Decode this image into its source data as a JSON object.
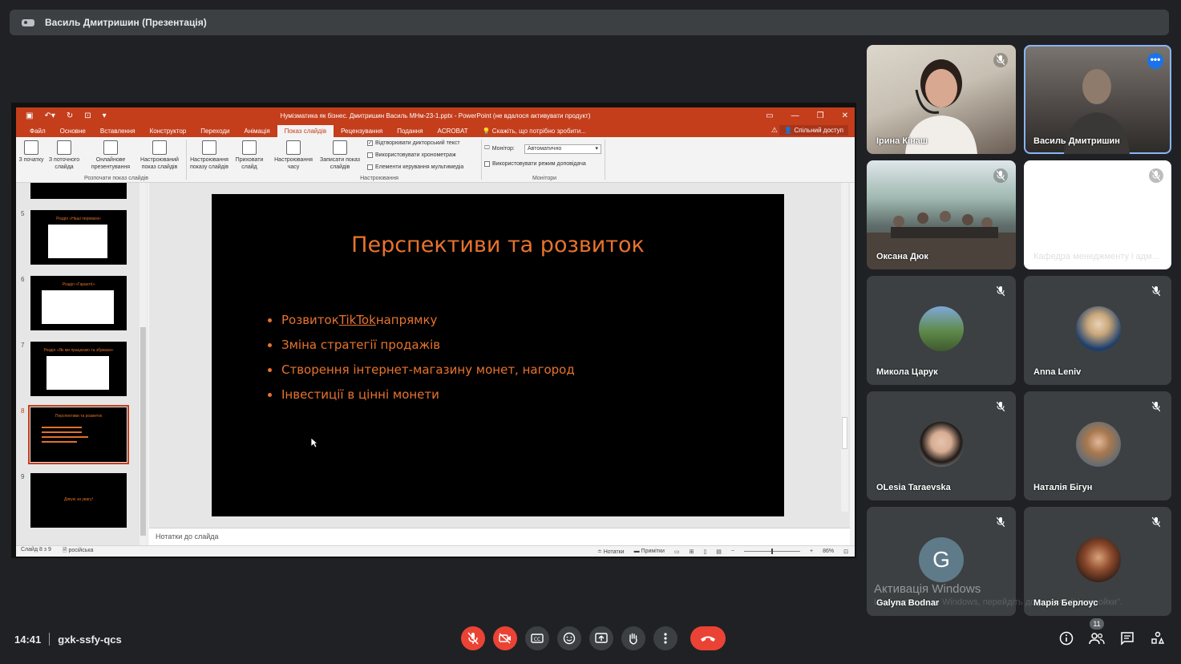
{
  "topbar": {
    "title": "Василь Дмитришин (Презентація)"
  },
  "ppt": {
    "doc_title": "Нумізматика як бізнес. Дмитришин Василь МНм-23-1.pptx - PowerPoint (не вдалося активувати продукт)",
    "tabs": [
      "Файл",
      "Основне",
      "Вставлення",
      "Конструктор",
      "Переходи",
      "Анімація",
      "Показ слайдів",
      "Рецензування",
      "Подання",
      "ACROBAT"
    ],
    "active_tab": "Показ слайдів",
    "tell_me": "Скажіть, що потрібно зробити...",
    "share": "Спільний доступ",
    "ribbon": {
      "btn_from_start": "З початку",
      "btn_from_current": "З поточного слайда",
      "btn_online": "Онлайнове презентування",
      "btn_custom": "Настроюваний показ слайдів",
      "group_start": "Розпочати показ слайдів",
      "btn_setup": "Настроювання показу слайдів",
      "btn_hide": "Приховати слайд",
      "btn_timings": "Настроювання часу",
      "btn_record": "Записати показ слайдів",
      "chk_narration": "Відтворювати дикторський текст",
      "chk_timings": "Використовувати хронометраж",
      "chk_media": "Елементи керування мультимедіа",
      "group_setup": "Настроювання",
      "monitor_label": "Монітор:",
      "monitor_value": "Автоматично",
      "chk_presenter": "Використовувати режим доповідача",
      "group_monitors": "Монітори"
    },
    "thumbnails": [
      {
        "num": "5",
        "title": "Розділ «Наші переваги»"
      },
      {
        "num": "6",
        "title": "Розділ «Гарантії»"
      },
      {
        "num": "7",
        "title": "Розділ «Як ми працюємо та збуваєм»"
      },
      {
        "num": "8",
        "title": "Перспективи та розвиток"
      },
      {
        "num": "9",
        "title": "Дякую за увагу!"
      }
    ],
    "slide": {
      "title": "Перспективи та розвиток",
      "bullet1_pre": "Розвиток ",
      "bullet1_link": "TikTok",
      "bullet1_post": " напрямку",
      "bullet2": "Зміна стратегії продажів",
      "bullet3": "Створення інтернет-магазину монет, нагород",
      "bullet4": "Інвестиції в цінні монети"
    },
    "notes_placeholder": "Нотатки до слайда",
    "status": {
      "slide_count": "Слайд 8 з 9",
      "language": "російська",
      "notes": "Нотатки",
      "comments": "Примітки",
      "zoom": "86%"
    }
  },
  "participants": [
    {
      "name": "Ірина Кінаш"
    },
    {
      "name": "Василь Дмитришин"
    },
    {
      "name": "Оксана Дюк"
    },
    {
      "name": "Кафедра менеджменту і адм..."
    },
    {
      "name": "Микола Царук"
    },
    {
      "name": "Anna Leniv"
    },
    {
      "name": "OLesia Taraevska"
    },
    {
      "name": "Наталія Бігун"
    },
    {
      "name": "Galyna Bodnar",
      "initial": "G"
    },
    {
      "name": "Марія Берлоус"
    }
  ],
  "watermark": {
    "line1": "Активація Windows",
    "line2": "Щоб активувати Windows, перейдіть до розділу \"Настройки\"."
  },
  "meeting": {
    "time": "14:41",
    "code": "gxk-ssfy-qcs",
    "participant_count": "11"
  },
  "colors": {
    "ppt_accent": "#c43e1c",
    "slide_text": "#e8732d",
    "hangup": "#ea4335",
    "active_speaker": "#1a73e8"
  }
}
